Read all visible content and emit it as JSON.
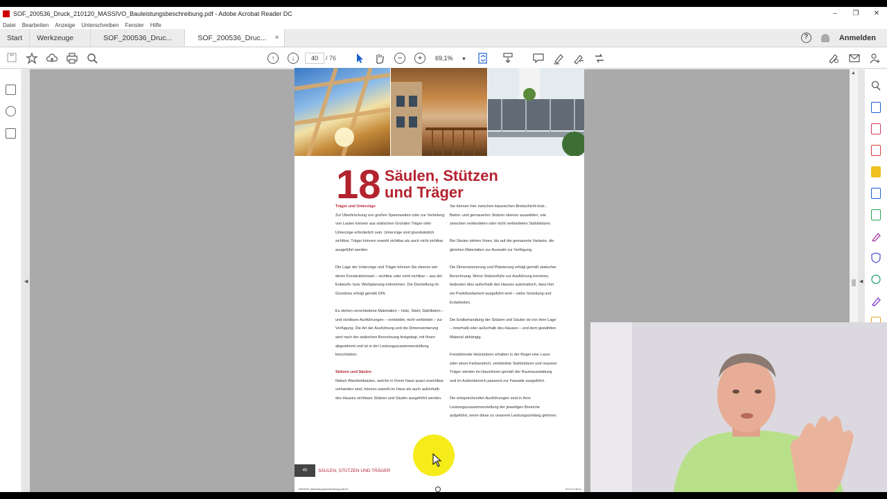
{
  "window": {
    "title": "SOF_200536_Druck_210120_MASSIVO_Bauleistungsbeschreibung.pdf - Adobe Acrobat Reader DC",
    "controls": [
      "–",
      "❐",
      "✕"
    ]
  },
  "menu": [
    "Datei",
    "Bearbeiten",
    "Anzeige",
    "Unterschreiben",
    "Fenster",
    "Hilfe"
  ],
  "tabs": {
    "home": "Start",
    "tools": "Werkzeuge",
    "doc1": "SOF_200536_Druc...",
    "doc2": "SOF_200536_Druc...",
    "close": "×"
  },
  "account": {
    "help": "?",
    "sign_in": "Anmelden"
  },
  "toolbar": {
    "current_page": "40",
    "total_pages": "/ 76",
    "zoom": "69,1%"
  },
  "icons": {
    "toolbar": [
      "save-icon",
      "bookmark-star-icon",
      "cloud-upload-icon",
      "print-icon",
      "search-icon",
      "page-up-icon",
      "page-down-icon",
      "select-cursor-icon",
      "hand-icon",
      "zoom-out-icon",
      "zoom-in-icon",
      "fit-page-icon",
      "scroll-mode-icon",
      "comment-icon",
      "highlight-pen-icon",
      "sign-icon",
      "share-icon"
    ],
    "right_panel": [
      "search-zoom-icon",
      "export-pdf-icon",
      "organize-pages-icon",
      "create-pdf-icon",
      "comment-icon",
      "combine-files-icon",
      "edit-pdf-icon",
      "fill-sign-icon",
      "protect-icon",
      "compress-icon",
      "redact-icon",
      "more-tools-icon"
    ]
  },
  "document": {
    "chapter_number": "18",
    "chapter_title_line1": "Säulen, Stützen",
    "chapter_title_line2": "und Träger",
    "col1": {
      "heading1": "Träger und Unterzüge",
      "p1": "Zur Überbrückung von großen Spannweiten oder zur Verteilung von Lasten können aus statischen Gründen Träger oder Unterzüge erforderlich sein. Unterzüge sind grundsätzlich sichtbar, Träger können sowohl sichtbar als auch nicht sichtbar ausgeführt werden.",
      "p2": "Die Lage der Unterzüge und Träger können Sie ebenso wie deren Konstruktionsart – sichtbar oder nicht sichtbar – aus der Entwurfs- bzw. Werkplanung entnehmen. Die Darstellung im Grundriss erfolgt gemäß DIN.",
      "p3": "Es stehen verschiedene Materialien – Holz, Stahl, Stahlbeton – und sichtbare Ausführungen – verkleidet, nicht verkleidet – zur Verfügung. Die Art der Ausführung und die Dimensionierung wird nach der statischen Berechnung festgelegt, mit Ihnen abgestimmt und ist in der Leistungszusammenstellung beschrieben.",
      "heading2": "Stützen und Säulen",
      "p4": "Neben Wandeinbauten, welche in Ihrem Haus quasi unsichtbar vorhanden sind, können sowohl im Haus als auch außerhalb des Hauses sichtbare Stützen und Säulen ausgeführt werden."
    },
    "col2": {
      "p1": "Sie können hier zwischen klassischen Breitschicht-holz-, Beton- und gemauerten Stützen ebenso auswählen, wie zwischen verkleideten oder nicht verkleideten Stahlstützen.",
      "p2": "Bei Säulen stehen Ihnen, bis auf die gemauerte Variante, die gleichen Materialien zur Auswahl zur Verfügung.",
      "p3": "Die Dimensionierung und Platzierung erfolgt gemäß statischer Berechnung. Wenn Stützenfüße zur Ausführung kommen, bedeuten dies außerhalb des Hauses automatisch, dass hier ein Punktfundament ausgeführt wird – siehe Gründung und Erdarbeiten.",
      "p4": "Die Endbehandlung der Stützen und Säulen ist von ihrer Lage – innerhalb oder außerhalb des Hauses – und dem gewählten Material abhängig.",
      "p5": "Freistehende Holzstützen erhalten in der Regel eine Lasur oder einen Farbanstrich, verkleidete Stahlstützen und massive Träger werden im Haus/innen gemäß der Raumausstattung und im Außenbereich passend zur Fassade ausgeführt.",
      "p6": "Die entsprechenden Ausführungen sind in Ihrer Leistungszusammenstellung der jeweiligen Bereiche aufgeführt, wenn diese zu unserem Leistungsumfang gehören."
    },
    "footer_page": "40",
    "footer_label": "SÄULEN, STÜTZEN UND TRÄGER",
    "print_slug": "MASSIVO_Bauleistungsbeschreibung.indd 40",
    "print_date": "20.01.21 08:41"
  },
  "colors": {
    "accent_red": "#b3232f",
    "cursor_highlight": "#f5ec1a",
    "canvas_gray": "#aaaaaa"
  }
}
